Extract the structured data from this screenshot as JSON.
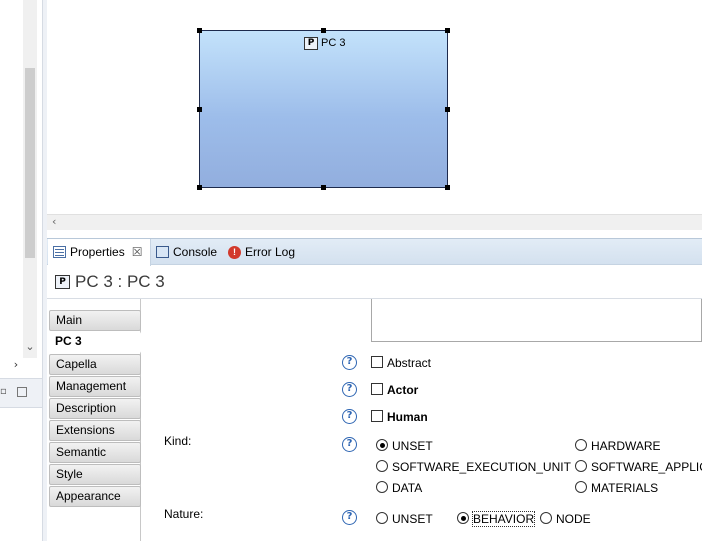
{
  "diagram": {
    "node_label": "PC 3",
    "node_icon_letter": "P"
  },
  "views": {
    "tabs": [
      {
        "label": "Properties",
        "icon": "properties-icon",
        "active": true
      },
      {
        "label": "Console",
        "icon": "console-icon",
        "active": false
      },
      {
        "label": "Error Log",
        "icon": "error-log-icon",
        "active": false
      }
    ]
  },
  "properties": {
    "title": "PC 3 : PC 3",
    "title_icon_letter": "P",
    "categories": [
      "Main",
      "PC 3",
      "Capella",
      "Management",
      "Description",
      "Extensions",
      "Semantic",
      "Style",
      "Appearance"
    ],
    "selected_category": "PC 3",
    "help_glyph": "?",
    "checkboxes": [
      {
        "label": "Abstract",
        "checked": false,
        "bold": false
      },
      {
        "label": "Actor",
        "checked": false,
        "bold": true
      },
      {
        "label": "Human",
        "checked": false,
        "bold": true
      }
    ],
    "kind": {
      "label": "Kind:",
      "options": [
        "UNSET",
        "HARDWARE",
        "SOFTWARE_EXECUTION_UNIT",
        "SOFTWARE_APPLICA",
        "DATA",
        "MATERIALS"
      ],
      "selected": "UNSET"
    },
    "nature": {
      "label": "Nature:",
      "options": [
        "UNSET",
        "BEHAVIOR",
        "NODE"
      ],
      "selected": "BEHAVIOR"
    }
  },
  "colors": {
    "node_fill_top": "#c3e2fb",
    "node_fill_bottom": "#92aede",
    "help_icon": "#2f66b3",
    "tabbar": "#d4e1ef"
  }
}
